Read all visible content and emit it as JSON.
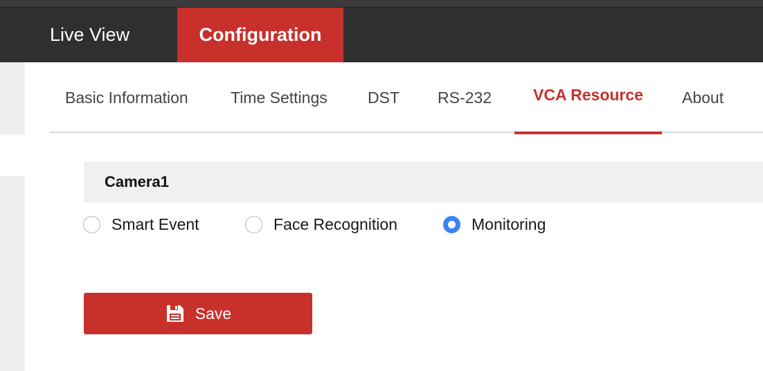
{
  "nav": {
    "items": [
      {
        "label": "Live View",
        "active": false
      },
      {
        "label": "Configuration",
        "active": true
      }
    ]
  },
  "subtabs": [
    {
      "label": "Basic Information",
      "active": false
    },
    {
      "label": "Time Settings",
      "active": false
    },
    {
      "label": "DST",
      "active": false
    },
    {
      "label": "RS-232",
      "active": false
    },
    {
      "label": "VCA Resource",
      "active": true
    },
    {
      "label": "About",
      "active": false
    }
  ],
  "camera": {
    "title": "Camera1",
    "options": [
      {
        "label": "Smart Event",
        "checked": false
      },
      {
        "label": "Face Recognition",
        "checked": false
      },
      {
        "label": "Monitoring",
        "checked": true
      }
    ]
  },
  "actions": {
    "save_label": "Save",
    "save_icon": "floppy-disk-icon"
  },
  "colors": {
    "accent": "#c8302b",
    "nav_bg": "#2f2f2f",
    "radio_checked": "#3b82f6"
  }
}
